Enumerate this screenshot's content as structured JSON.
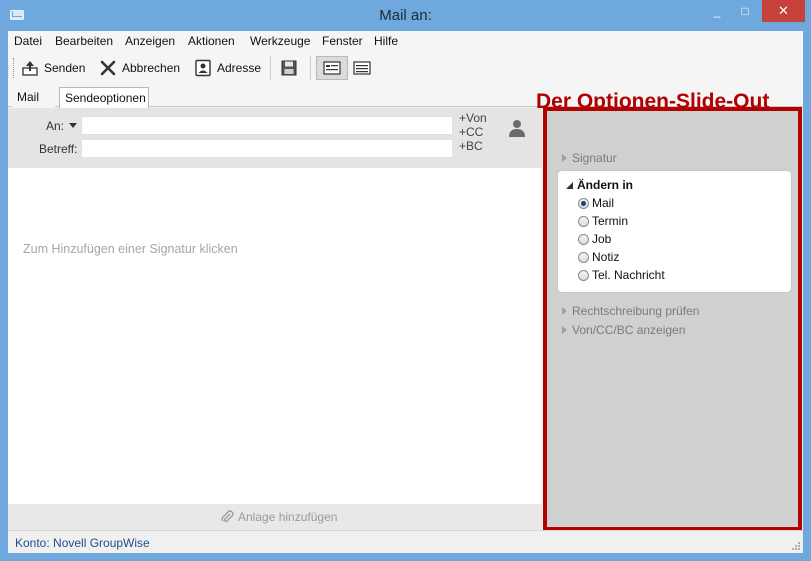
{
  "window": {
    "title": "Mail an:",
    "minimize": "_",
    "maximize": "□",
    "close": "✕"
  },
  "menu": [
    "Datei",
    "Bearbeiten",
    "Anzeigen",
    "Aktionen",
    "Werkzeuge",
    "Fenster",
    "Hilfe"
  ],
  "toolbar": {
    "send": "Senden",
    "cancel": "Abbrechen",
    "address": "Adresse"
  },
  "annotation": "Der Optionen-Slide-Out",
  "tabs": [
    "Mail",
    "Sendeoptionen"
  ],
  "header": {
    "to_label": "An:",
    "subject_label": "Betreff:",
    "from_link": "Von",
    "cc_link": "CC",
    "bc_link": "BC",
    "plus": "+"
  },
  "body": {
    "signature_placeholder": "Zum Hinzufügen einer Signatur klicken"
  },
  "attach": {
    "label": "Anlage hinzufügen"
  },
  "panel": {
    "signature": "Signatur",
    "change_in": {
      "title": "Ändern in",
      "options": [
        "Mail",
        "Termin",
        "Job",
        "Notiz",
        "Tel. Nachricht"
      ],
      "selected": "Mail"
    },
    "spellcheck": "Rechtschreibung prüfen",
    "show_from_cc_bc": "Von/CC/BC anzeigen"
  },
  "status": {
    "account": "Konto: Novell GroupWise"
  },
  "colors": {
    "frame": "#6fa8dc",
    "annotation": "#b30000",
    "close": "#c7423a",
    "status_text": "#1f4f8a"
  }
}
